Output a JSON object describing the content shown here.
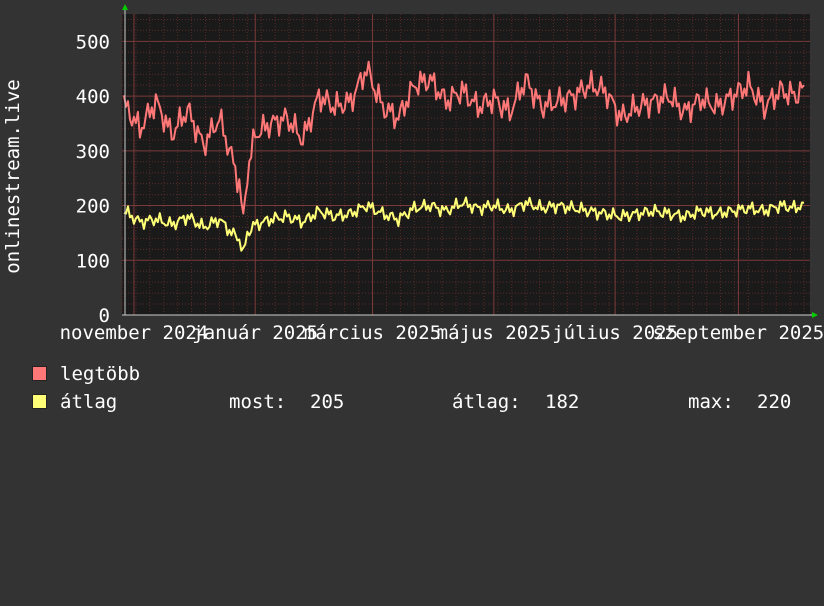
{
  "chart_data": {
    "type": "line",
    "ylabel": "onlinestream.live",
    "ylim": [
      0,
      550
    ],
    "yticks": [
      0,
      100,
      200,
      300,
      400,
      500
    ],
    "x_range": [
      "2024-10-26",
      "2025-10-07"
    ],
    "x_tick_labels": [
      "november 2024",
      "január 2025",
      "március 2025",
      "május 2025",
      "július 2025",
      "szeptember 2025"
    ],
    "x_tick_dates": [
      "2024-11-01",
      "2025-01-01",
      "2025-03-01",
      "2025-05-01",
      "2025-07-01",
      "2025-09-01"
    ],
    "grid": true,
    "series": [
      {
        "name": "legtöbb",
        "color": "#ff7777",
        "x": [
          "2024-10-27",
          "2024-11-04",
          "2024-11-12",
          "2024-11-20",
          "2024-11-28",
          "2024-12-06",
          "2024-12-14",
          "2024-12-20",
          "2024-12-24",
          "2024-12-26",
          "2024-12-28",
          "2025-01-01",
          "2025-01-09",
          "2025-01-17",
          "2025-01-25",
          "2025-02-02",
          "2025-02-10",
          "2025-02-18",
          "2025-02-26",
          "2025-03-06",
          "2025-03-14",
          "2025-03-22",
          "2025-03-30",
          "2025-04-07",
          "2025-04-15",
          "2025-04-23",
          "2025-05-01",
          "2025-05-09",
          "2025-05-17",
          "2025-05-25",
          "2025-06-02",
          "2025-06-10",
          "2025-06-18",
          "2025-06-26",
          "2025-07-04",
          "2025-07-12",
          "2025-07-20",
          "2025-07-28",
          "2025-08-05",
          "2025-08-13",
          "2025-08-21",
          "2025-08-29",
          "2025-09-06",
          "2025-09-14",
          "2025-09-22",
          "2025-09-30",
          "2025-10-04"
        ],
        "values": [
          385,
          340,
          390,
          330,
          375,
          310,
          360,
          290,
          240,
          170,
          260,
          330,
          350,
          360,
          320,
          400,
          380,
          390,
          450,
          380,
          360,
          420,
          430,
          390,
          410,
          380,
          395,
          370,
          430,
          380,
          390,
          400,
          420,
          410,
          360,
          380,
          390,
          400,
          370,
          395,
          380,
          400,
          420,
          380,
          410,
          400,
          420
        ]
      },
      {
        "name": "átlag",
        "color": "#ffff77",
        "x": [
          "2024-10-27",
          "2024-11-04",
          "2024-11-12",
          "2024-11-20",
          "2024-11-28",
          "2024-12-06",
          "2024-12-14",
          "2024-12-20",
          "2024-12-24",
          "2024-12-26",
          "2024-12-28",
          "2025-01-01",
          "2025-01-09",
          "2025-01-17",
          "2025-01-25",
          "2025-02-02",
          "2025-02-10",
          "2025-02-18",
          "2025-02-26",
          "2025-03-06",
          "2025-03-14",
          "2025-03-22",
          "2025-03-30",
          "2025-04-07",
          "2025-04-15",
          "2025-04-23",
          "2025-05-01",
          "2025-05-09",
          "2025-05-17",
          "2025-05-25",
          "2025-06-02",
          "2025-06-10",
          "2025-06-18",
          "2025-06-26",
          "2025-07-04",
          "2025-07-12",
          "2025-07-20",
          "2025-07-28",
          "2025-08-05",
          "2025-08-13",
          "2025-08-21",
          "2025-08-29",
          "2025-09-06",
          "2025-09-14",
          "2025-09-22",
          "2025-09-30",
          "2025-10-04"
        ],
        "values": [
          190,
          170,
          175,
          165,
          180,
          160,
          175,
          150,
          140,
          110,
          150,
          165,
          175,
          180,
          170,
          190,
          180,
          185,
          200,
          185,
          175,
          195,
          200,
          190,
          205,
          195,
          200,
          190,
          205,
          195,
          200,
          195,
          190,
          185,
          180,
          185,
          190,
          185,
          180,
          190,
          185,
          190,
          195,
          190,
          200,
          195,
          205
        ]
      }
    ]
  },
  "legend": {
    "items": [
      {
        "label": "legtöbb",
        "color": "#ff7777"
      },
      {
        "label": "átlag",
        "color": "#ffff77"
      }
    ],
    "stats": {
      "most_label": "most:",
      "most_value": "205",
      "avg_label": "átlag:",
      "avg_value": "182",
      "max_label": "max:",
      "max_value": "220"
    }
  },
  "colors": {
    "background": "#333333",
    "plot_background": "#1a1a1a",
    "grid_minor": "#5a2a2a",
    "grid_major": "#7a3a3a",
    "axis_arrow": "#00cc00"
  }
}
